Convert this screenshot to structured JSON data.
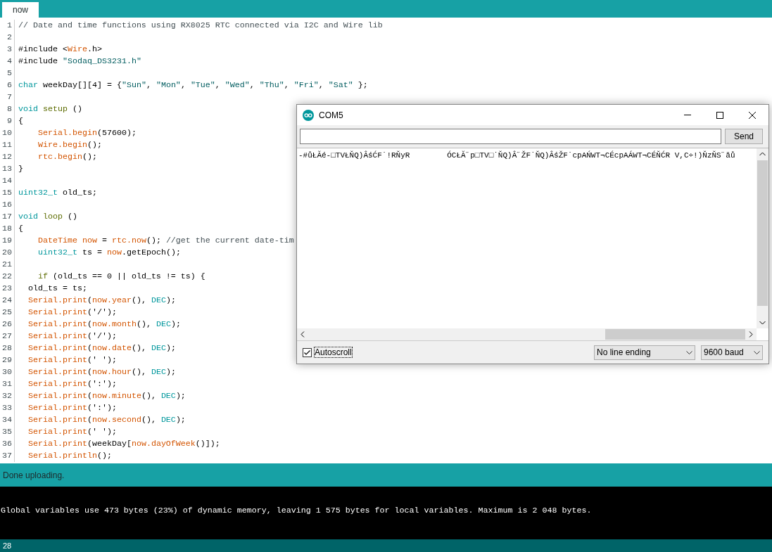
{
  "editor": {
    "tabs": [
      {
        "label": "now",
        "selected": true
      }
    ],
    "lines": [
      {
        "number": "1",
        "tokens": [
          {
            "kind": "cmt",
            "text": "// Date and time functions using RX8025 RTC connected via I2C and Wire lib"
          }
        ]
      },
      {
        "number": "2"
      },
      {
        "number": "3",
        "tokens": [
          {
            "kind": "plain",
            "text": "#include <"
          },
          {
            "kind": "fn",
            "text": "Wire"
          },
          {
            "kind": "plain",
            "text": ".h>"
          }
        ]
      },
      {
        "number": "4",
        "tokens": [
          {
            "kind": "plain",
            "text": "#include "
          },
          {
            "kind": "str",
            "text": "\"Sodaq_DS3231.h\""
          }
        ]
      },
      {
        "number": "5"
      },
      {
        "number": "6",
        "tokens": [
          {
            "kind": "kw",
            "text": "char"
          },
          {
            "kind": "plain",
            "text": " weekDay[][4] = {"
          },
          {
            "kind": "str",
            "text": "\"Sun\""
          },
          {
            "kind": "plain",
            "text": ", "
          },
          {
            "kind": "str",
            "text": "\"Mon\""
          },
          {
            "kind": "plain",
            "text": ", "
          },
          {
            "kind": "str",
            "text": "\"Tue\""
          },
          {
            "kind": "plain",
            "text": ", "
          },
          {
            "kind": "str",
            "text": "\"Wed\""
          },
          {
            "kind": "plain",
            "text": ", "
          },
          {
            "kind": "str",
            "text": "\"Thu\""
          },
          {
            "kind": "plain",
            "text": ", "
          },
          {
            "kind": "str",
            "text": "\"Fri\""
          },
          {
            "kind": "plain",
            "text": ", "
          },
          {
            "kind": "str",
            "text": "\"Sat\""
          },
          {
            "kind": "plain",
            "text": " };"
          }
        ]
      },
      {
        "number": "7"
      },
      {
        "number": "8",
        "tokens": [
          {
            "kind": "kw",
            "text": "void "
          },
          {
            "kind": "ctrl",
            "text": "setup"
          },
          {
            "kind": "plain",
            "text": " ()"
          }
        ]
      },
      {
        "number": "9",
        "tokens": [
          {
            "kind": "plain",
            "text": "{"
          }
        ]
      },
      {
        "number": "10",
        "tokens": [
          {
            "kind": "fn",
            "text": "    Serial.begin"
          },
          {
            "kind": "plain",
            "text": "(57600);"
          }
        ]
      },
      {
        "number": "11",
        "tokens": [
          {
            "kind": "fn",
            "text": "    Wire.begin"
          },
          {
            "kind": "plain",
            "text": "();"
          }
        ]
      },
      {
        "number": "12",
        "tokens": [
          {
            "kind": "fn",
            "text": "    rtc.begin"
          },
          {
            "kind": "plain",
            "text": "();"
          }
        ]
      },
      {
        "number": "13",
        "tokens": [
          {
            "kind": "plain",
            "text": "}"
          }
        ]
      },
      {
        "number": "14"
      },
      {
        "number": "15",
        "tokens": [
          {
            "kind": "kw",
            "text": "uint32_t"
          },
          {
            "kind": "plain",
            "text": " old_ts;"
          }
        ]
      },
      {
        "number": "16"
      },
      {
        "number": "17",
        "tokens": [
          {
            "kind": "kw",
            "text": "void "
          },
          {
            "kind": "ctrl",
            "text": "loop"
          },
          {
            "kind": "plain",
            "text": " ()"
          }
        ]
      },
      {
        "number": "18",
        "tokens": [
          {
            "kind": "plain",
            "text": "{"
          }
        ]
      },
      {
        "number": "19",
        "tokens": [
          {
            "kind": "fn",
            "text": "    DateTime now"
          },
          {
            "kind": "plain",
            "text": " = "
          },
          {
            "kind": "fn",
            "text": "rtc.now"
          },
          {
            "kind": "plain",
            "text": "(); "
          },
          {
            "kind": "cmt",
            "text": "//get the current date-tim"
          }
        ]
      },
      {
        "number": "20",
        "tokens": [
          {
            "kind": "kw",
            "text": "    uint32_t"
          },
          {
            "kind": "plain",
            "text": " ts = "
          },
          {
            "kind": "fn",
            "text": "now"
          },
          {
            "kind": "plain",
            "text": ".getEpoch();"
          }
        ]
      },
      {
        "number": "21"
      },
      {
        "number": "22",
        "tokens": [
          {
            "kind": "ctrl",
            "text": "    if"
          },
          {
            "kind": "plain",
            "text": " (old_ts == 0 || old_ts != ts) {"
          }
        ]
      },
      {
        "number": "23",
        "tokens": [
          {
            "kind": "plain",
            "text": "  old_ts = ts;"
          }
        ]
      },
      {
        "number": "24",
        "tokens": [
          {
            "kind": "fn",
            "text": "  Serial.print"
          },
          {
            "kind": "plain",
            "text": "("
          },
          {
            "kind": "fn",
            "text": "now.year"
          },
          {
            "kind": "plain",
            "text": "(), "
          },
          {
            "kind": "kw",
            "text": "DEC"
          },
          {
            "kind": "plain",
            "text": ");"
          }
        ]
      },
      {
        "number": "25",
        "tokens": [
          {
            "kind": "fn",
            "text": "  Serial.print"
          },
          {
            "kind": "plain",
            "text": "('/');"
          }
        ]
      },
      {
        "number": "26",
        "tokens": [
          {
            "kind": "fn",
            "text": "  Serial.print"
          },
          {
            "kind": "plain",
            "text": "("
          },
          {
            "kind": "fn",
            "text": "now.month"
          },
          {
            "kind": "plain",
            "text": "(), "
          },
          {
            "kind": "kw",
            "text": "DEC"
          },
          {
            "kind": "plain",
            "text": ");"
          }
        ]
      },
      {
        "number": "27",
        "tokens": [
          {
            "kind": "fn",
            "text": "  Serial.print"
          },
          {
            "kind": "plain",
            "text": "('/');"
          }
        ]
      },
      {
        "number": "28",
        "tokens": [
          {
            "kind": "fn",
            "text": "  Serial.print"
          },
          {
            "kind": "plain",
            "text": "("
          },
          {
            "kind": "fn",
            "text": "now.date"
          },
          {
            "kind": "plain",
            "text": "(), "
          },
          {
            "kind": "kw",
            "text": "DEC"
          },
          {
            "kind": "plain",
            "text": ");"
          }
        ]
      },
      {
        "number": "29",
        "tokens": [
          {
            "kind": "fn",
            "text": "  Serial.print"
          },
          {
            "kind": "plain",
            "text": "(' ');"
          }
        ]
      },
      {
        "number": "30",
        "tokens": [
          {
            "kind": "fn",
            "text": "  Serial.print"
          },
          {
            "kind": "plain",
            "text": "("
          },
          {
            "kind": "fn",
            "text": "now.hour"
          },
          {
            "kind": "plain",
            "text": "(), "
          },
          {
            "kind": "kw",
            "text": "DEC"
          },
          {
            "kind": "plain",
            "text": ");"
          }
        ]
      },
      {
        "number": "31",
        "tokens": [
          {
            "kind": "fn",
            "text": "  Serial.print"
          },
          {
            "kind": "plain",
            "text": "(':');"
          }
        ]
      },
      {
        "number": "32",
        "tokens": [
          {
            "kind": "fn",
            "text": "  Serial.print"
          },
          {
            "kind": "plain",
            "text": "("
          },
          {
            "kind": "fn",
            "text": "now.minute"
          },
          {
            "kind": "plain",
            "text": "(), "
          },
          {
            "kind": "kw",
            "text": "DEC"
          },
          {
            "kind": "plain",
            "text": ");"
          }
        ]
      },
      {
        "number": "33",
        "tokens": [
          {
            "kind": "fn",
            "text": "  Serial.print"
          },
          {
            "kind": "plain",
            "text": "(':');"
          }
        ]
      },
      {
        "number": "34",
        "tokens": [
          {
            "kind": "fn",
            "text": "  Serial.print"
          },
          {
            "kind": "plain",
            "text": "("
          },
          {
            "kind": "fn",
            "text": "now.second"
          },
          {
            "kind": "plain",
            "text": "(), "
          },
          {
            "kind": "kw",
            "text": "DEC"
          },
          {
            "kind": "plain",
            "text": ");"
          }
        ]
      },
      {
        "number": "35",
        "tokens": [
          {
            "kind": "fn",
            "text": "  Serial.print"
          },
          {
            "kind": "plain",
            "text": "(' ');"
          }
        ]
      },
      {
        "number": "36",
        "tokens": [
          {
            "kind": "fn",
            "text": "  Serial.print"
          },
          {
            "kind": "plain",
            "text": "(weekDay["
          },
          {
            "kind": "fn",
            "text": "now.dayOfWeek"
          },
          {
            "kind": "plain",
            "text": "()]);"
          }
        ]
      },
      {
        "number": "37",
        "tokens": [
          {
            "kind": "fn",
            "text": "  Serial.println"
          },
          {
            "kind": "plain",
            "text": "();"
          }
        ]
      }
    ]
  },
  "status": {
    "message": "Done uploading."
  },
  "console": {
    "lines": [
      "Global variables use 473 bytes (23%) of dynamic memory, leaving 1 575 bytes for local variables. Maximum is 2 048 bytes."
    ]
  },
  "footer": {
    "line_number": "28"
  },
  "serial_monitor": {
    "title": "COM5",
    "send_button": "Send",
    "output": "-#ůŁĂé-□TVŁŇQ)ÂśĆF˙!RŇyR        ÓCŁĂ˝p□TV□˙ŇQ)Â˝ŽF˙ŇQ)ÂśŽF˙cpAŃWT¬CÉcpAÁWT¬CÉŇĆR V,C÷!)ŇzŇS˝ăů",
    "autoscroll": {
      "label": "Autoscroll",
      "checked": true
    },
    "line_ending": "No line ending",
    "baud": "9600 baud"
  }
}
